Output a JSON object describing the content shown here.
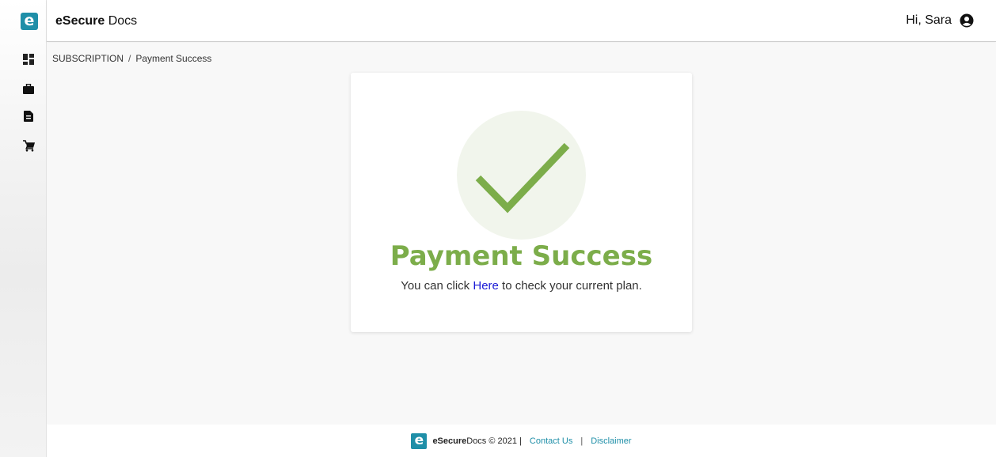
{
  "app": {
    "logo_letter": "e",
    "brand_bold": "eSecure",
    "brand_rest": " Docs",
    "accent_color": "#1f8fa8"
  },
  "header": {
    "greeting": "Hi, Sara"
  },
  "sidebar": {
    "items": [
      {
        "icon": "dashboard-icon"
      },
      {
        "icon": "briefcase-icon"
      },
      {
        "icon": "document-icon"
      },
      {
        "icon": "cart-icon"
      }
    ]
  },
  "breadcrumb": {
    "parent": "SUBSCRIPTION",
    "separator": "/",
    "current": "Payment Success"
  },
  "card": {
    "title": "Payment Success",
    "text_before": "You can click ",
    "link": "Here",
    "text_after": " to check your current plan.",
    "success_color": "#7cad4a"
  },
  "footer": {
    "brand_bold": "eSecure",
    "brand_rest": " Docs © 2021 |",
    "contact": "Contact Us",
    "divider": "|",
    "disclaimer": "Disclaimer"
  }
}
